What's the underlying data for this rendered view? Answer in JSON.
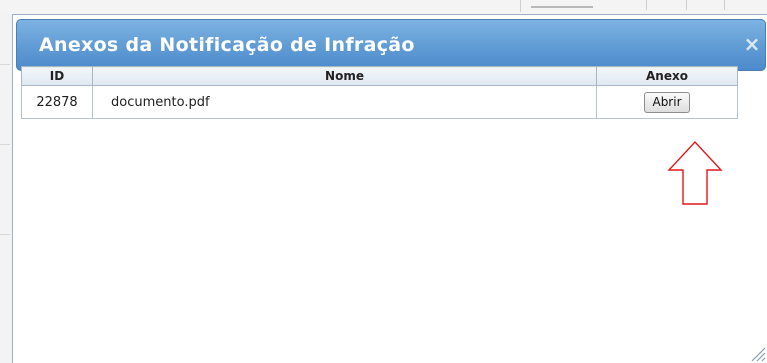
{
  "dialog": {
    "title": "Anexos da Notificação de Infração",
    "close_glyph": "×"
  },
  "table": {
    "columns": [
      "ID",
      "Nome",
      "Anexo"
    ],
    "rows": [
      {
        "id": "22878",
        "nome": "documento.pdf",
        "anexo_button": "Abrir"
      }
    ]
  },
  "annotation": {
    "icon": "red-outline-up-arrow",
    "color": "#e0181c"
  },
  "colors": {
    "titlebar": "#5f9bd4",
    "header_bg": "#e6edf4"
  }
}
